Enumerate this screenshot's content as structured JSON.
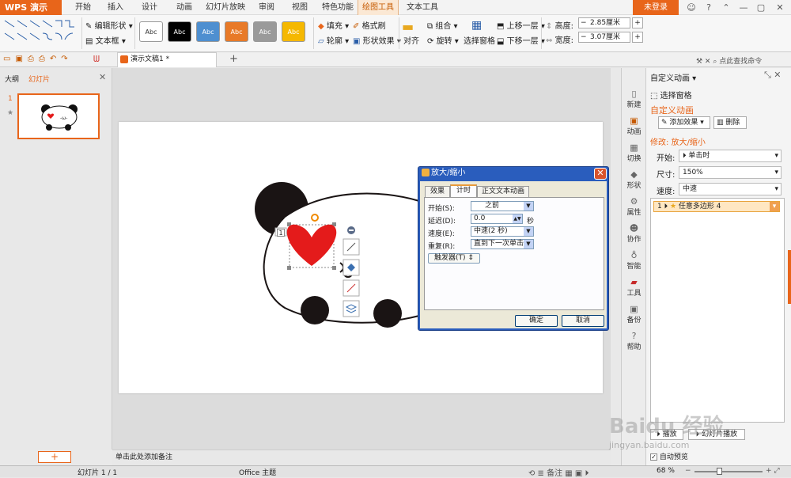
{
  "app": {
    "name": "WPS 演示",
    "login": "未登录",
    "min": "—",
    "restore": "▢",
    "close": "✕"
  },
  "tabs": [
    "开始",
    "插入",
    "设计",
    "动画",
    "幻灯片放映",
    "审阅",
    "视图",
    "特色功能",
    "绘图工具",
    "文本工具"
  ],
  "ribbon": {
    "edit_shape": "编辑形状",
    "text_box": "文本框",
    "style_label": "Abc",
    "fill": "填充",
    "format_brush": "格式刷",
    "outline": "轮廓",
    "shape_effect": "形状效果",
    "align": "对齐",
    "group": "组合",
    "rotate": "旋转",
    "select_pane": "选择窗格",
    "bring_forward": "上移一层",
    "send_backward": "下移一层",
    "height_label": "高度:",
    "height_value": "2.85厘米",
    "width_label": "宽度:",
    "width_value": "3.07厘米",
    "find_cmd": "点此查找命令"
  },
  "doc_tab": "演示文稿1 *",
  "left_panel": {
    "outline_tab": "大纲",
    "slides_tab": "幻灯片",
    "slide_number": "1"
  },
  "notes_placeholder": "单击此处添加备注",
  "status": {
    "slide": "幻灯片 1 / 1",
    "theme": "Office 主题",
    "notes": "备注",
    "zoom": "68 %"
  },
  "vertical_tools": [
    "新建",
    "动画",
    "切换",
    "形状",
    "属性",
    "协作",
    "智能",
    "工具",
    "备份",
    "帮助"
  ],
  "right_pane": {
    "title": "自定义动画",
    "select_pane": "选择窗格",
    "section": "自定义动画",
    "add_effect": "添加效果",
    "delete": "删除",
    "modify": "修改: 放大/缩小",
    "start_label": "开始:",
    "start_value": "单击时",
    "size_label": "尺寸:",
    "size_value": "150%",
    "speed_label": "速度:",
    "speed_value": "中速",
    "list_item": "任意多边形 4",
    "list_num": "1",
    "play": "播放",
    "slideshow": "幻灯片播放",
    "autopreview": "自动预览"
  },
  "dialog": {
    "title": "放大/缩小",
    "tabs": [
      "效果",
      "计时",
      "正文文本动画"
    ],
    "start_label": "开始(S):",
    "start_value": "之前",
    "delay_label": "延迟(D):",
    "delay_value": "0.0",
    "delay_unit": "秒",
    "speed_label": "速度(E):",
    "speed_value": "中速(2 秒)",
    "repeat_label": "重复(R):",
    "repeat_value": "直到下一次单击",
    "trigger": "触发器(T)",
    "ok": "确定",
    "cancel": "取消"
  },
  "slide": {
    "anim_badge": "1"
  },
  "watermark": {
    "line1": "Baidu 经验",
    "line2": "jingyan.baidu.com"
  }
}
